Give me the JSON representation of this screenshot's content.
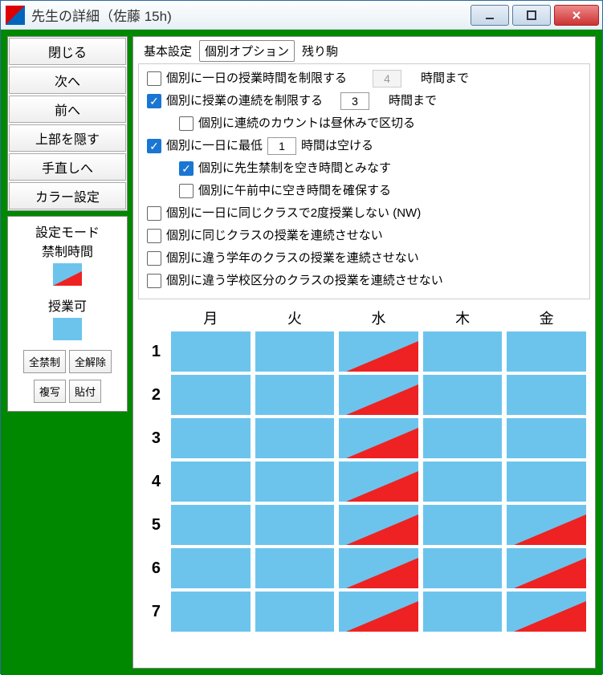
{
  "window": {
    "title": "先生の詳細（佐藤 15h)"
  },
  "win_controls": {
    "min": "minimize",
    "max": "maximize",
    "close": "close"
  },
  "sidebar_buttons": [
    "閉じる",
    "次へ",
    "前へ",
    "上部を隠す",
    "手直しへ",
    "カラー設定"
  ],
  "mode_panel": {
    "title": "設定モード",
    "forbid_label": "禁制時間",
    "avail_label": "授業可",
    "all_forbid": "全禁制",
    "all_clear": "全解除",
    "copy": "複写",
    "paste": "貼付"
  },
  "tabs": [
    "基本設定",
    "個別オプション",
    "残り駒"
  ],
  "active_tab": 1,
  "options": {
    "o1": {
      "checked": false,
      "label": "個別に一日の授業時間を制限する",
      "value": "4",
      "suffix": "時間まで",
      "disabled": true
    },
    "o2": {
      "checked": true,
      "label": "個別に授業の連続を制限する",
      "value": "3",
      "suffix": "時間まで"
    },
    "o2a": {
      "checked": false,
      "label": "個別に連続のカウントは昼休みで区切る"
    },
    "o3": {
      "checked": true,
      "label": "個別に一日に最低",
      "value": "1",
      "suffix": "時間は空ける"
    },
    "o3a": {
      "checked": true,
      "label": "個別に先生禁制を空き時間とみなす"
    },
    "o3b": {
      "checked": false,
      "label": "個別に午前中に空き時間を確保する"
    },
    "o4": {
      "checked": false,
      "label": "個別に一日に同じクラスで2度授業しない (NW)"
    },
    "o5": {
      "checked": false,
      "label": "個別に同じクラスの授業を連続させない"
    },
    "o6": {
      "checked": false,
      "label": "個別に違う学年のクラスの授業を連続させない"
    },
    "o7": {
      "checked": false,
      "label": "個別に違う学校区分のクラスの授業を連続させない"
    }
  },
  "days": [
    "月",
    "火",
    "水",
    "木",
    "金"
  ],
  "periods": [
    "1",
    "2",
    "3",
    "4",
    "5",
    "6",
    "7"
  ],
  "grid": [
    [
      "A",
      "A",
      "F",
      "A",
      "A"
    ],
    [
      "A",
      "A",
      "F",
      "A",
      "A"
    ],
    [
      "A",
      "A",
      "F",
      "A",
      "A"
    ],
    [
      "A",
      "A",
      "F",
      "A",
      "A"
    ],
    [
      "A",
      "A",
      "F",
      "A",
      "F"
    ],
    [
      "A",
      "A",
      "F",
      "A",
      "F"
    ],
    [
      "A",
      "A",
      "F",
      "A",
      "F"
    ]
  ],
  "colors": {
    "available": "#6cc4ed",
    "forbid": "#e22222",
    "frame_green": "#008800"
  }
}
